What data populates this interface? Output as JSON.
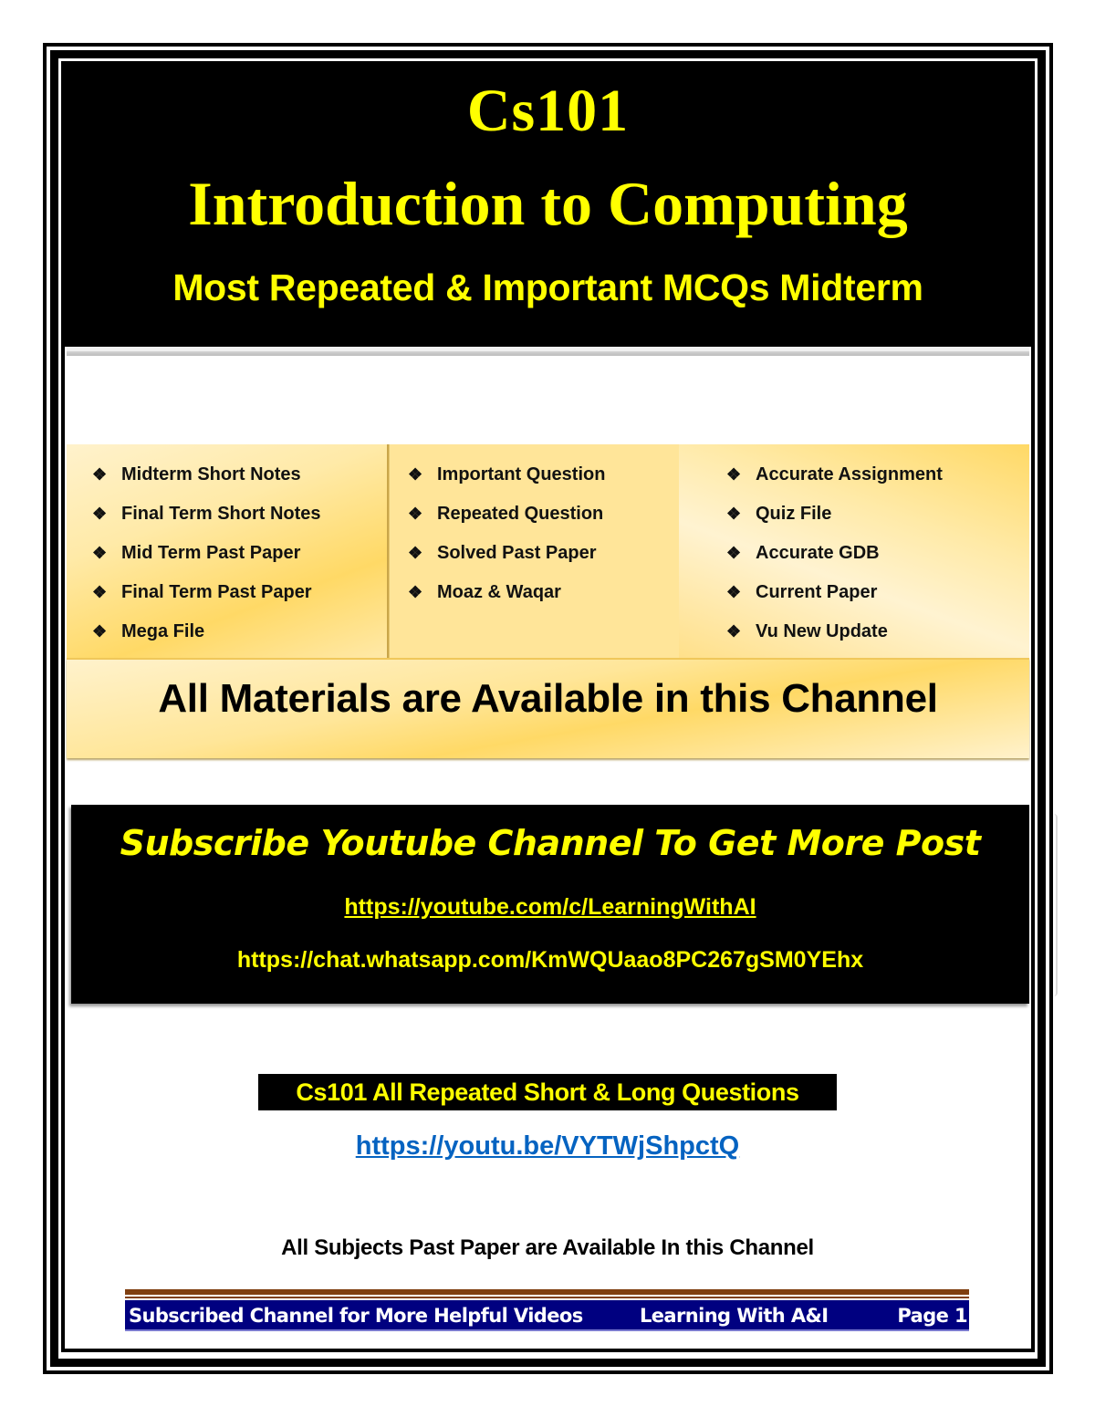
{
  "header": {
    "course_code": "Cs101",
    "course_title": "Introduction to Computing",
    "subtitle": "Most Repeated & Important MCQs Midterm"
  },
  "panel": {
    "bullet_icon": "❖",
    "columns": [
      {
        "items": [
          "Midterm Short  Notes",
          "Final Term Short Notes",
          "Mid Term Past Paper",
          "Final Term Past Paper",
          "Mega File"
        ]
      },
      {
        "items": [
          "Important Question",
          "Repeated Question",
          "Solved Past Paper",
          "Moaz & Waqar"
        ]
      },
      {
        "items": [
          "Accurate Assignment",
          "Quiz File",
          "Accurate GDB",
          "Current Paper",
          "Vu New Update"
        ]
      }
    ],
    "banner": "All Materials are Available in this Channel"
  },
  "subscribe": {
    "heading": "Subscribe Youtube Channel To Get More Post",
    "youtube_link": "https://youtube.com/c/LearningWithAI",
    "whatsapp_link": "https://chat.whatsapp.com/KmWQUaao8PC267gSM0YEhx"
  },
  "questions": {
    "heading": "Cs101 All Repeated Short & Long Questions",
    "link": "https://youtu.be/VYTWjShpctQ"
  },
  "all_subjects_text": "All Subjects Past Paper are Available In this Channel",
  "footer": {
    "left": "Subscribed Channel  for More Helpful Videos",
    "middle": "Learning With A&I",
    "page": "Page 1"
  },
  "colors": {
    "header_bg": "#000000",
    "accent_yellow": "#ffff00",
    "panel_gold": "#ffd966",
    "link_blue": "#0563c1",
    "footer_navy": "#000080",
    "footer_rule": "#7f3f10"
  }
}
